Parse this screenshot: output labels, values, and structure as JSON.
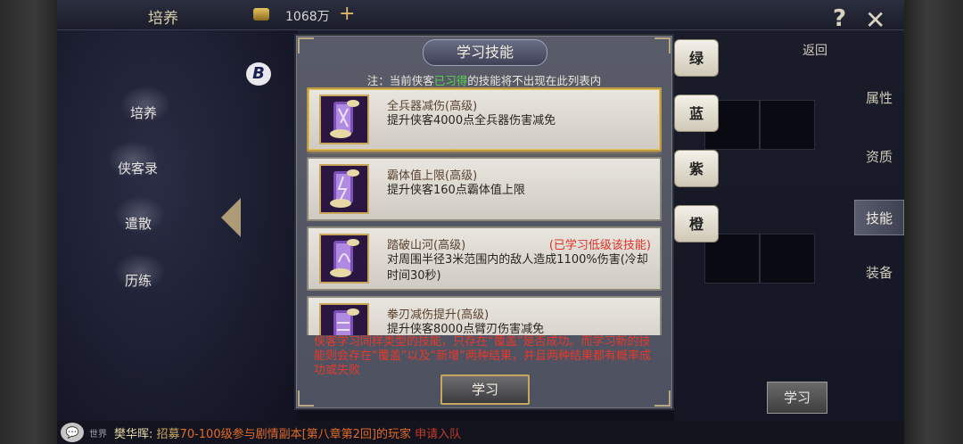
{
  "topbar": {
    "title": "培养",
    "gold_amount": "1068万",
    "plus": "+",
    "help": "?",
    "close": "✕"
  },
  "back_label": "返回",
  "badge_letter": "B",
  "left_nav": {
    "items": [
      {
        "label": "培养"
      },
      {
        "label": "侠客录"
      },
      {
        "label": "遣散"
      },
      {
        "label": "历练"
      }
    ]
  },
  "side_tabs": {
    "items": [
      {
        "label": "属性"
      },
      {
        "label": "资质"
      },
      {
        "label": "技能"
      },
      {
        "label": "装备"
      }
    ],
    "active": "技能"
  },
  "color_tabs": [
    {
      "label": "绿"
    },
    {
      "label": "蓝"
    },
    {
      "label": "紫"
    },
    {
      "label": "橙"
    }
  ],
  "bg_learn_button": "学习",
  "modal": {
    "title": "学习技能",
    "note_prefix": "注：当前侠客",
    "note_highlight": "已习得",
    "note_suffix": "的技能将不出现在此列表内",
    "skills": [
      {
        "name": "全兵器减伤(高级)",
        "desc": "提升侠客4000点全兵器伤害减免",
        "learned_note": ""
      },
      {
        "name": "霸体值上限(高级)",
        "desc": "提升侠客160点霸体值上限",
        "learned_note": ""
      },
      {
        "name": "踏破山河(高级)",
        "desc": "对周围半径3米范围内的敌人造成1100%伤害(冷却时间30秒)",
        "learned_note": "(已学习低级该技能)"
      },
      {
        "name": "拳刃减伤提升(高级)",
        "desc": "提升侠客8000点臂刃伤害减免",
        "learned_note": ""
      }
    ],
    "warning": "侠客学习同样类型的技能，只存在“覆盖”是否成功。而学习新的技能则会存在“覆盖”以及“新增”两种结果，并且两种结果都有概率成功或失败",
    "learn_button": "学习"
  },
  "chat": {
    "icon": "💬",
    "channel": "世界",
    "speaker": "樊华晖:",
    "message_prefix": "招募",
    "message_highlight": "70-100级参与剧情副本[第八章第2回]的玩家",
    "apply_text": "申请入队"
  },
  "colors": {
    "accent_gold": "#c9a75a",
    "warning_red": "#e43a2c",
    "note_green": "#58d34e"
  }
}
